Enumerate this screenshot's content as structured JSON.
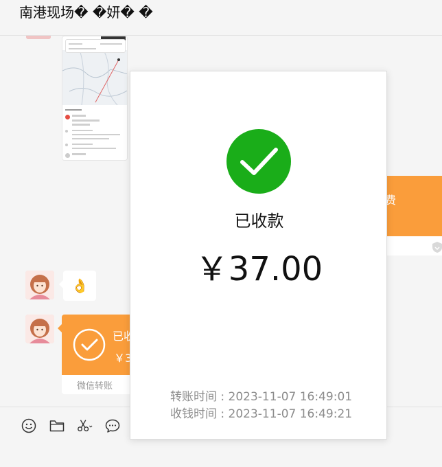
{
  "header": {
    "title": "南港现场� �妍� �"
  },
  "chat": {
    "orange_right_card": {
      "label": "费"
    },
    "emoji_message": {
      "emoji": "👌"
    },
    "transfer_message": {
      "status": "已收",
      "amount": "￥3",
      "source": "微信转账"
    }
  },
  "toolbar": {
    "tools": [
      {
        "icon": "emoji-icon"
      },
      {
        "icon": "folder-icon"
      },
      {
        "icon": "scissors-icon"
      },
      {
        "icon": "chat-bubble-icon"
      }
    ]
  },
  "popup": {
    "status": "已收款",
    "amount": "￥37.00",
    "transfer_time": "转账时间 : 2023-11-07 16:49:01",
    "receive_time": "收钱时间 : 2023-11-07 16:49:21",
    "success_color": "#1aad19"
  },
  "colors": {
    "transfer_orange": "#fa9d3b",
    "background": "#f5f5f5"
  }
}
